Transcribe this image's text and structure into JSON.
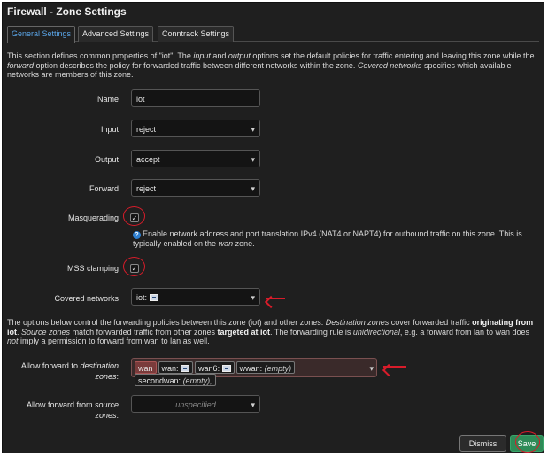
{
  "window": {
    "title": "Firewall - Zone Settings"
  },
  "tabs": [
    {
      "label": "General Settings",
      "active": true
    },
    {
      "label": "Advanced Settings",
      "active": false
    },
    {
      "label": "Conntrack Settings",
      "active": false
    }
  ],
  "intro": {
    "p1": "This section defines common properties of \"iot\". The ",
    "input_word": "input",
    "p2": " and ",
    "output_word": "output",
    "p3": " options set the default policies for traffic entering and leaving this zone while the ",
    "forward_word": "forward",
    "p4": " option describes the policy for forwarded traffic between different networks within the zone. ",
    "covered_word": "Covered networks",
    "p5": " specifies which available networks are members of this zone."
  },
  "form": {
    "name_label": "Name",
    "name_value": "iot",
    "input_label": "Input",
    "input_value": "reject",
    "output_label": "Output",
    "output_value": "accept",
    "forward_label": "Forward",
    "forward_value": "reject",
    "masq_label": "Masquerading",
    "masq_checked": true,
    "masq_help_1": "Enable network address and port translation IPv4 (NAT4 or NAPT4) for outbound traffic on this zone. This is typically enabled on the ",
    "masq_help_wan": "wan",
    "masq_help_2": " zone.",
    "mss_label": "MSS clamping",
    "mss_checked": true,
    "covered_label": "Covered networks",
    "covered_value": "iot:"
  },
  "forwarding_intro": {
    "p1": "The options below control the forwarding policies between this zone (iot) and other zones. ",
    "dest_zones": "Destination zones",
    "p2": " cover forwarded traffic ",
    "orig_bold": "originating from iot",
    "p3": ". ",
    "src_zones": "Source zones",
    "p4": " match forwarded traffic from other zones ",
    "target_bold": "targeted at iot",
    "p5": ". The forwarding rule is ",
    "unidir": "unidirectional",
    "p6": ", e.g. a forward from lan to wan does ",
    "not_word": "not",
    "p7": " imply a permission to forward from wan to lan as well."
  },
  "dest": {
    "label_1": "Allow forward to ",
    "label_italic": "destination",
    "label_2": "zones",
    "label_colon": ":",
    "chips": [
      {
        "name": "wan",
        "selected": true,
        "suffix": "",
        "icon": false
      },
      {
        "name": "wan:",
        "selected": false,
        "suffix": "",
        "icon": true
      },
      {
        "name": "wan6:",
        "selected": false,
        "suffix": "",
        "icon": true
      },
      {
        "name": "wwan:",
        "selected": false,
        "suffix": "(empty)",
        "icon": false
      },
      {
        "name": "secondwan:",
        "selected": false,
        "suffix": "(empty),",
        "icon": false
      }
    ]
  },
  "src": {
    "label_1": "Allow forward from ",
    "label_italic": "source",
    "label_2": "zones",
    "label_colon": ":",
    "placeholder": "unspecified"
  },
  "buttons": {
    "dismiss": "Dismiss",
    "save": "Save"
  },
  "colors": {
    "panel_bg": "#1f1f1f",
    "annotation_red": "#d81c2a",
    "save_green": "#2e8b57",
    "tab_active": "#5aa4e6"
  },
  "icons": {
    "checkmark": "✓",
    "caret": "▾",
    "help": "?"
  }
}
